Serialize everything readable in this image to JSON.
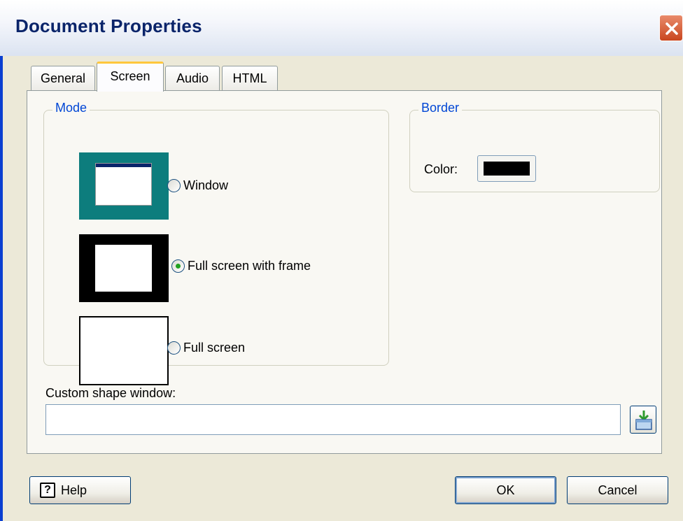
{
  "window": {
    "title": "Document Properties"
  },
  "tabs": [
    {
      "label": "General",
      "active": false
    },
    {
      "label": "Screen",
      "active": true
    },
    {
      "label": "Audio",
      "active": false
    },
    {
      "label": "HTML",
      "active": false
    }
  ],
  "mode": {
    "legend": "Mode",
    "options": [
      {
        "label": "Window",
        "selected": false
      },
      {
        "label": "Full screen with frame",
        "selected": true
      },
      {
        "label": "Full screen",
        "selected": false
      }
    ]
  },
  "border": {
    "legend": "Border",
    "color_label": "Color:",
    "color_value": "#000000"
  },
  "custom_shape": {
    "label": "Custom shape window:",
    "value": ""
  },
  "buttons": {
    "help": "Help",
    "ok": "OK",
    "cancel": "Cancel"
  },
  "colors": {
    "title_text": "#0a246a",
    "accent_blue": "#0046d5",
    "teal_desktop": "#0d7d7d",
    "tab_highlight": "#ffc73c"
  },
  "icons": {
    "close": "close-icon",
    "browse": "folder-open-icon",
    "help": "help-icon"
  }
}
